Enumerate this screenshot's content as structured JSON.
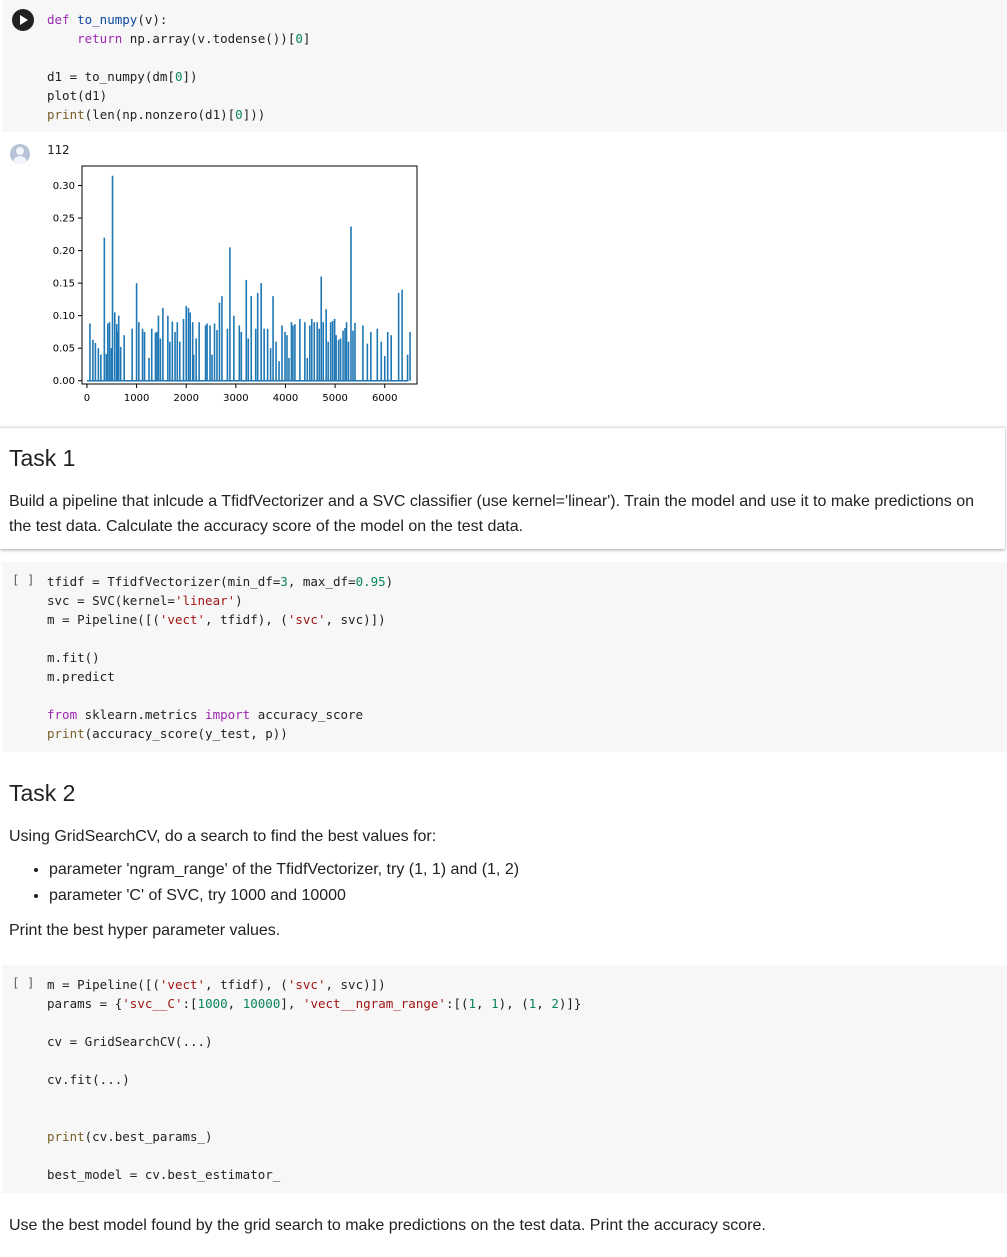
{
  "cell1": {
    "lines": [
      [
        [
          "kw",
          "def"
        ],
        [
          "t",
          " "
        ],
        [
          "blue",
          "to_numpy"
        ],
        [
          "t",
          "(v):"
        ]
      ],
      [
        [
          "t",
          "    "
        ],
        [
          "kw",
          "return"
        ],
        [
          "t",
          " np.array(v.todense())["
        ],
        [
          "num",
          "0"
        ],
        [
          "t",
          "]"
        ]
      ],
      [
        [
          "t",
          ""
        ]
      ],
      [
        [
          "t",
          "d1 = to_numpy(dm["
        ],
        [
          "num",
          "0"
        ],
        [
          "t",
          "])"
        ]
      ],
      [
        [
          "t",
          "plot(d1)"
        ]
      ],
      [
        [
          "fn",
          "print"
        ],
        [
          "t",
          "(len(np.nonzero(d1)["
        ],
        [
          "num",
          "0"
        ],
        [
          "t",
          "]))"
        ]
      ]
    ]
  },
  "output": {
    "text": "112"
  },
  "chart_data": {
    "type": "bar",
    "xlim": [
      -100,
      6650
    ],
    "ylim": [
      -0.005,
      0.33
    ],
    "xticks": [
      "0",
      "1000",
      "2000",
      "3000",
      "4000",
      "5000",
      "6000"
    ],
    "yticks": [
      "0.00",
      "0.05",
      "0.10",
      "0.15",
      "0.20",
      "0.25",
      "0.30"
    ],
    "x": [
      60,
      120,
      170,
      230,
      280,
      350,
      390,
      420,
      455,
      490,
      515,
      560,
      600,
      620,
      640,
      680,
      750,
      910,
      1000,
      1045,
      1120,
      1160,
      1250,
      1305,
      1380,
      1410,
      1440,
      1480,
      1530,
      1630,
      1670,
      1720,
      1775,
      1820,
      1870,
      1945,
      2000,
      2045,
      2080,
      2130,
      2150,
      2200,
      2260,
      2390,
      2420,
      2480,
      2520,
      2570,
      2620,
      2670,
      2720,
      2830,
      2880,
      2960,
      3070,
      3110,
      3210,
      3250,
      3310,
      3400,
      3440,
      3510,
      3570,
      3640,
      3700,
      3750,
      3810,
      3870,
      3930,
      3990,
      4030,
      4070,
      4120,
      4150,
      4190,
      4290,
      4390,
      4440,
      4490,
      4530,
      4580,
      4640,
      4680,
      4720,
      4760,
      4820,
      4860,
      4910,
      4950,
      4990,
      5020,
      5070,
      5110,
      5160,
      5200,
      5230,
      5270,
      5320,
      5360,
      5400,
      5560,
      5650,
      5720,
      5850,
      5930,
      6000,
      6060,
      6130,
      6280,
      6350,
      6460,
      6510
    ],
    "values": [
      0.088,
      0.063,
      0.058,
      0.05,
      0.04,
      0.22,
      0.041,
      0.088,
      0.09,
      0.05,
      0.315,
      0.105,
      0.087,
      0.075,
      0.1,
      0.052,
      0.07,
      0.08,
      0.15,
      0.09,
      0.08,
      0.075,
      0.035,
      0.08,
      0.074,
      0.075,
      0.1,
      0.065,
      0.112,
      0.1,
      0.06,
      0.091,
      0.075,
      0.09,
      0.06,
      0.095,
      0.115,
      0.112,
      0.105,
      0.09,
      0.04,
      0.065,
      0.09,
      0.085,
      0.088,
      0.085,
      0.04,
      0.088,
      0.078,
      0.12,
      0.13,
      0.08,
      0.205,
      0.1,
      0.085,
      0.075,
      0.155,
      0.065,
      0.13,
      0.08,
      0.135,
      0.15,
      0.08,
      0.08,
      0.05,
      0.13,
      0.06,
      0.03,
      0.085,
      0.075,
      0.07,
      0.035,
      0.09,
      0.085,
      0.087,
      0.095,
      0.09,
      0.035,
      0.085,
      0.095,
      0.09,
      0.09,
      0.08,
      0.16,
      0.09,
      0.11,
      0.06,
      0.09,
      0.092,
      0.095,
      0.07,
      0.063,
      0.065,
      0.077,
      0.081,
      0.09,
      0.06,
      0.237,
      0.077,
      0.089,
      0.085,
      0.057,
      0.075,
      0.08,
      0.06,
      0.038,
      0.075,
      0.07,
      0.135,
      0.14,
      0.04,
      0.075
    ]
  },
  "task1": {
    "title": "Task 1",
    "text": "Build a pipeline that inlcude a TfidfVectorizer and a SVC classifier (use kernel='linear'). Train the model and use it to make predictions on the test data. Calculate the accuracy score of the model on the test data."
  },
  "cell2": {
    "bracket": "[ ]",
    "lines": [
      [
        [
          "t",
          "tfidf = TfidfVectorizer(min_df="
        ],
        [
          "num",
          "3"
        ],
        [
          "t",
          ", max_df="
        ],
        [
          "num",
          "0.95"
        ],
        [
          "t",
          ")"
        ]
      ],
      [
        [
          "t",
          "svc = SVC(kernel="
        ],
        [
          "str",
          "'linear'"
        ],
        [
          "t",
          ")"
        ]
      ],
      [
        [
          "t",
          "m = Pipeline([("
        ],
        [
          "str",
          "'vect'"
        ],
        [
          "t",
          ", tfidf), ("
        ],
        [
          "str",
          "'svc'"
        ],
        [
          "t",
          ", svc)])"
        ]
      ],
      [
        [
          "t",
          ""
        ]
      ],
      [
        [
          "t",
          "m.fit()"
        ]
      ],
      [
        [
          "t",
          "m.predict"
        ]
      ],
      [
        [
          "t",
          ""
        ]
      ],
      [
        [
          "kw",
          "from"
        ],
        [
          "t",
          " sklearn.metrics "
        ],
        [
          "kw",
          "import"
        ],
        [
          "t",
          " accuracy_score"
        ]
      ],
      [
        [
          "fn",
          "print"
        ],
        [
          "t",
          "(accuracy_score(y_test, p))"
        ]
      ]
    ]
  },
  "task2": {
    "title": "Task 2",
    "intro": "Using GridSearchCV, do a search to find the best values for:",
    "bullets": [
      "parameter 'ngram_range' of the TfidfVectorizer, try (1, 1) and (1, 2)",
      "parameter 'C' of SVC, try 1000 and 10000"
    ],
    "outro": "Print the best hyper parameter values."
  },
  "cell3": {
    "bracket": "[ ]",
    "lines": [
      [
        [
          "t",
          "m = Pipeline([("
        ],
        [
          "str",
          "'vect'"
        ],
        [
          "t",
          ", tfidf), ("
        ],
        [
          "str",
          "'svc'"
        ],
        [
          "t",
          ", svc)])"
        ]
      ],
      [
        [
          "t",
          "params = {"
        ],
        [
          "str",
          "'svc__C'"
        ],
        [
          "t",
          ":["
        ],
        [
          "num",
          "1000"
        ],
        [
          "t",
          ", "
        ],
        [
          "num",
          "10000"
        ],
        [
          "t",
          "], "
        ],
        [
          "str",
          "'vect__ngram_range'"
        ],
        [
          "t",
          ":[("
        ],
        [
          "num",
          "1"
        ],
        [
          "t",
          ", "
        ],
        [
          "num",
          "1"
        ],
        [
          "t",
          "), ("
        ],
        [
          "num",
          "1"
        ],
        [
          "t",
          ", "
        ],
        [
          "num",
          "2"
        ],
        [
          "t",
          ")]}"
        ]
      ],
      [
        [
          "t",
          ""
        ]
      ],
      [
        [
          "t",
          "cv = GridSearchCV(...)"
        ]
      ],
      [
        [
          "t",
          ""
        ]
      ],
      [
        [
          "t",
          "cv.fit(...)"
        ]
      ],
      [
        [
          "t",
          ""
        ]
      ],
      [
        [
          "t",
          ""
        ]
      ],
      [
        [
          "fn",
          "print"
        ],
        [
          "t",
          "(cv.best_params_)"
        ]
      ],
      [
        [
          "t",
          ""
        ]
      ],
      [
        [
          "t",
          "best_model = cv.best_estimator_"
        ]
      ]
    ]
  },
  "final_text": "Use the best model found by the grid search to make predictions on the test data. Print the accuracy score."
}
